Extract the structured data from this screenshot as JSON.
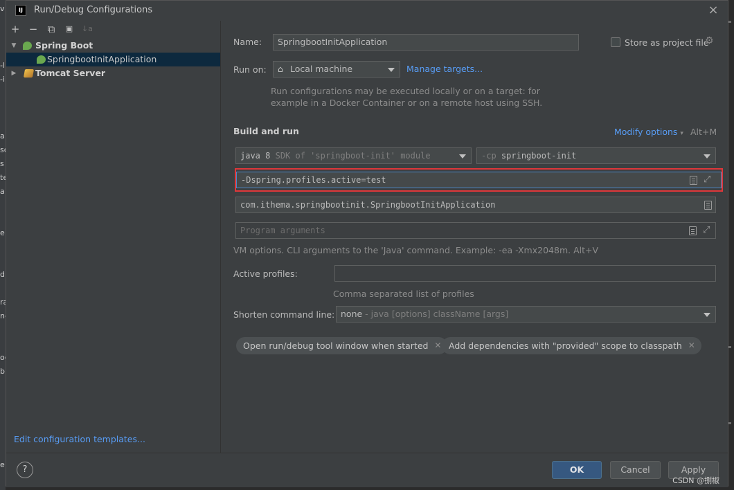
{
  "background": {
    "left_fragments": [
      "v",
      "-l",
      "-i",
      "a",
      "sc",
      "s",
      "te",
      "a",
      "e",
      "d",
      "ra",
      "nc",
      "oc",
      "b",
      "e"
    ],
    "right_fragment": "g"
  },
  "dialog": {
    "app_icon": "IJ",
    "title": "Run/Debug Configurations",
    "close_icon": "×"
  },
  "toolbar": {
    "add": "+",
    "remove": "−",
    "copy": "⧉",
    "folder": "▣",
    "sort": "↓a"
  },
  "tree": [
    {
      "label": "Spring Boot",
      "icon": "spring-boot-icon",
      "expanded": true
    },
    {
      "label": "SpringbootInitApplication",
      "icon": "spring-run-config-icon",
      "selected": true
    },
    {
      "label": "Tomcat Server",
      "icon": "tomcat-icon",
      "expanded": false
    }
  ],
  "edit_templates_link": "Edit configuration templates...",
  "name": {
    "label": "Name:",
    "value": "SpringbootInitApplication"
  },
  "store_as_project_file": {
    "label": "Store as project file",
    "checked": false
  },
  "run_on": {
    "label": "Run on:",
    "value": "Local machine",
    "manage_link": "Manage targets...",
    "hint_line1": "Run configurations may be executed locally or on a target: for",
    "hint_line2": "example in a Docker Container or on a remote host using SSH."
  },
  "build_and_run": {
    "section_title": "Build and run",
    "modify_options": "Modify options",
    "modify_shortcut": "Alt+M",
    "jre": "java 8",
    "jre_detail": "SDK of 'springboot-init' module",
    "cp_prefix": "-cp",
    "cp_module": "springboot-init",
    "vm_options": "-Dspring.profiles.active=test",
    "main_class": "com.ithema.springbootinit.SpringbootInitApplication",
    "program_args_placeholder": "Program arguments",
    "vm_hint": "VM options. CLI arguments to the 'Java' command. Example: -ea -Xmx2048m. Alt+V"
  },
  "active_profiles": {
    "label": "Active profiles:",
    "value": "",
    "hint": "Comma separated list of profiles"
  },
  "shorten_command_line": {
    "label": "Shorten command line:",
    "value": "none",
    "detail": "- java [options] className [args]"
  },
  "chips": [
    "Open run/debug tool window when started",
    "Add dependencies with \"provided\" scope to classpath"
  ],
  "buttons": {
    "help": "?",
    "ok": "OK",
    "cancel": "Cancel",
    "apply": "Apply"
  },
  "watermark": "CSDN @捌椒",
  "colors": {
    "link": "#589df6",
    "selection": "#0d293e",
    "highlight_border": "#e0373a",
    "primary_button": "#365880"
  }
}
